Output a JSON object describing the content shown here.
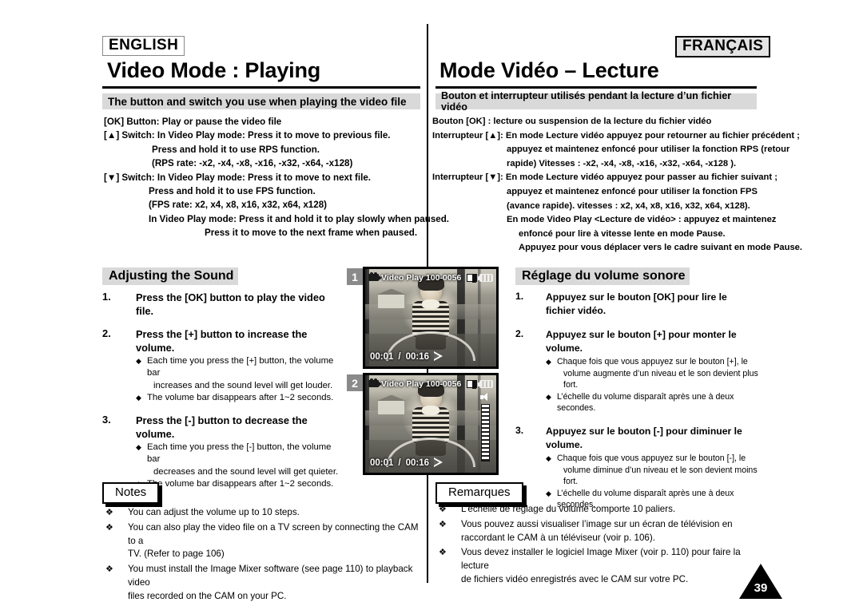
{
  "page": {
    "number": "39"
  },
  "english": {
    "lang_tag": "ENGLISH",
    "chapter_title": "Video Mode : Playing",
    "section_banner": "The button and switch you use when playing the video file",
    "spec_lines": [
      "[OK] Button: Play or pause the video file",
      "[▲] Switch:  In Video Play mode: Press it to move to previous file.",
      "Press and hold it to use RPS function.",
      "(RPS rate: -x2, -x4, -x8, -x16, -x32, -x64, -x128)",
      "[▼] Switch: In Video Play mode: Press it to move to next file.",
      "Press and hold it to use FPS function.",
      "(FPS rate: x2, x4, x8, x16, x32, x64, x128)",
      "In Video Play mode: Press it and hold it to play slowly when paused.",
      "Press it to move to the next frame when paused."
    ],
    "sub_banner": "Adjusting the Sound",
    "steps": [
      {
        "num": "1.",
        "head": "Press the [OK] button to play the video file.",
        "bullets": []
      },
      {
        "num": "2.",
        "head": "Press the [+] button to increase the volume.",
        "bullets": [
          {
            "line1": "Each time you press the [+] button, the volume bar",
            "line2": "increases and the sound level will get louder."
          },
          {
            "line1": "The volume bar disappears after 1~2 seconds.",
            "line2": ""
          }
        ]
      },
      {
        "num": "3.",
        "head": "Press the [-] button to decrease the volume.",
        "bullets": [
          {
            "line1": "Each time you press the [-] button, the volume bar",
            "line2": "decreases and the sound level will get quieter."
          },
          {
            "line1": "The volume bar disappears after 1~2 seconds.",
            "line2": ""
          }
        ]
      }
    ],
    "notes_tag": "Notes",
    "notes": [
      {
        "line1": "You can adjust the volume up to 10 steps.",
        "line2": ""
      },
      {
        "line1": "You can also play the video file on a TV screen by connecting the CAM to a",
        "line2": "TV. (Refer to page 106)"
      },
      {
        "line1": "You must install the Image Mixer software (see page 110) to playback video",
        "line2": "files recorded on  the CAM on your PC."
      }
    ]
  },
  "french": {
    "lang_tag": "FRANÇAIS",
    "chapter_title": "Mode Vidéo – Lecture",
    "section_banner": "Bouton et interrupteur utilisés pendant la lecture d’un fichier vidéo",
    "spec_lines": [
      "Bouton [OK] : lecture ou suspension de la lecture du fichier vidéo",
      "Interrupteur [▲]: En mode Lecture vidéo appuyez pour retourner au fichier précédent ;",
      "appuyez et maintenez enfoncé pour utiliser la fonction RPS (retour",
      "rapide) Vitesses : -x2, -x4, -x8, -x16, -x32, -x64, -x128 ).",
      "Interrupteur [▼]: En mode Lecture vidéo appuyez pour passer au fichier suivant ;",
      "appuyez et maintenez enfoncé pour utiliser la fonction FPS",
      "(avance rapide). vitesses : x2, x4, x8, x16, x32, x64, x128).",
      "En mode Video Play <Lecture de vidéo> : appuyez et maintenez",
      "enfoncé pour lire à vitesse lente en mode Pause.",
      "Appuyez pour vous déplacer vers le cadre suivant en mode Pause."
    ],
    "sub_banner": "Réglage du volume sonore",
    "steps": [
      {
        "num": "1.",
        "head": "Appuyez sur le bouton [OK] pour lire le",
        "head2": "fichier vidéo.",
        "bullets": []
      },
      {
        "num": "2.",
        "head": "Appuyez sur le bouton [+] pour monter le volume.",
        "head2": "",
        "bullets": [
          {
            "line1": "Chaque fois que vous appuyez sur le bouton [+], le",
            "line2": "volume augmente d’un niveau et le son devient plus fort."
          },
          {
            "line1": "L’échelle du volume disparaît après une à deux secondes.",
            "line2": ""
          }
        ]
      },
      {
        "num": "3.",
        "head": "Appuyez sur le bouton [-] pour diminuer le",
        "head2": "volume.",
        "bullets": [
          {
            "line1": "Chaque fois que vous appuyez sur le bouton [-], le",
            "line2": "volume diminue d’un niveau et le son devient moins fort."
          },
          {
            "line1": "L’échelle du volume disparaît après une à deux secondes.",
            "line2": ""
          }
        ]
      }
    ],
    "notes_tag": "Remarques",
    "notes": [
      {
        "line1": "L’échelle de réglage du volume comporte 10 paliers.",
        "line2": ""
      },
      {
        "line1": "Vous pouvez aussi visualiser l’image sur un écran de télévision en",
        "line2": "raccordant le CAM à un téléviseur (voir p. 106)."
      },
      {
        "line1": "Vous devez installer le logiciel Image Mixer (voir p. 110) pour faire la lecture",
        "line2": "de fichiers vidéo enregistrés avec le CAM  sur votre PC."
      }
    ]
  },
  "screenshots": [
    {
      "badge": "1",
      "osd_mode": "Video Play",
      "osd_file": "100-0056",
      "time_elapsed": "00:01",
      "time_total": "00:16",
      "separator": "/",
      "volume_bar_visible": false
    },
    {
      "badge": "2",
      "osd_mode": "Video Play",
      "osd_file": "100-0056",
      "time_elapsed": "00:01",
      "time_total": "00:16",
      "separator": "/",
      "volume_bar_visible": true
    }
  ]
}
